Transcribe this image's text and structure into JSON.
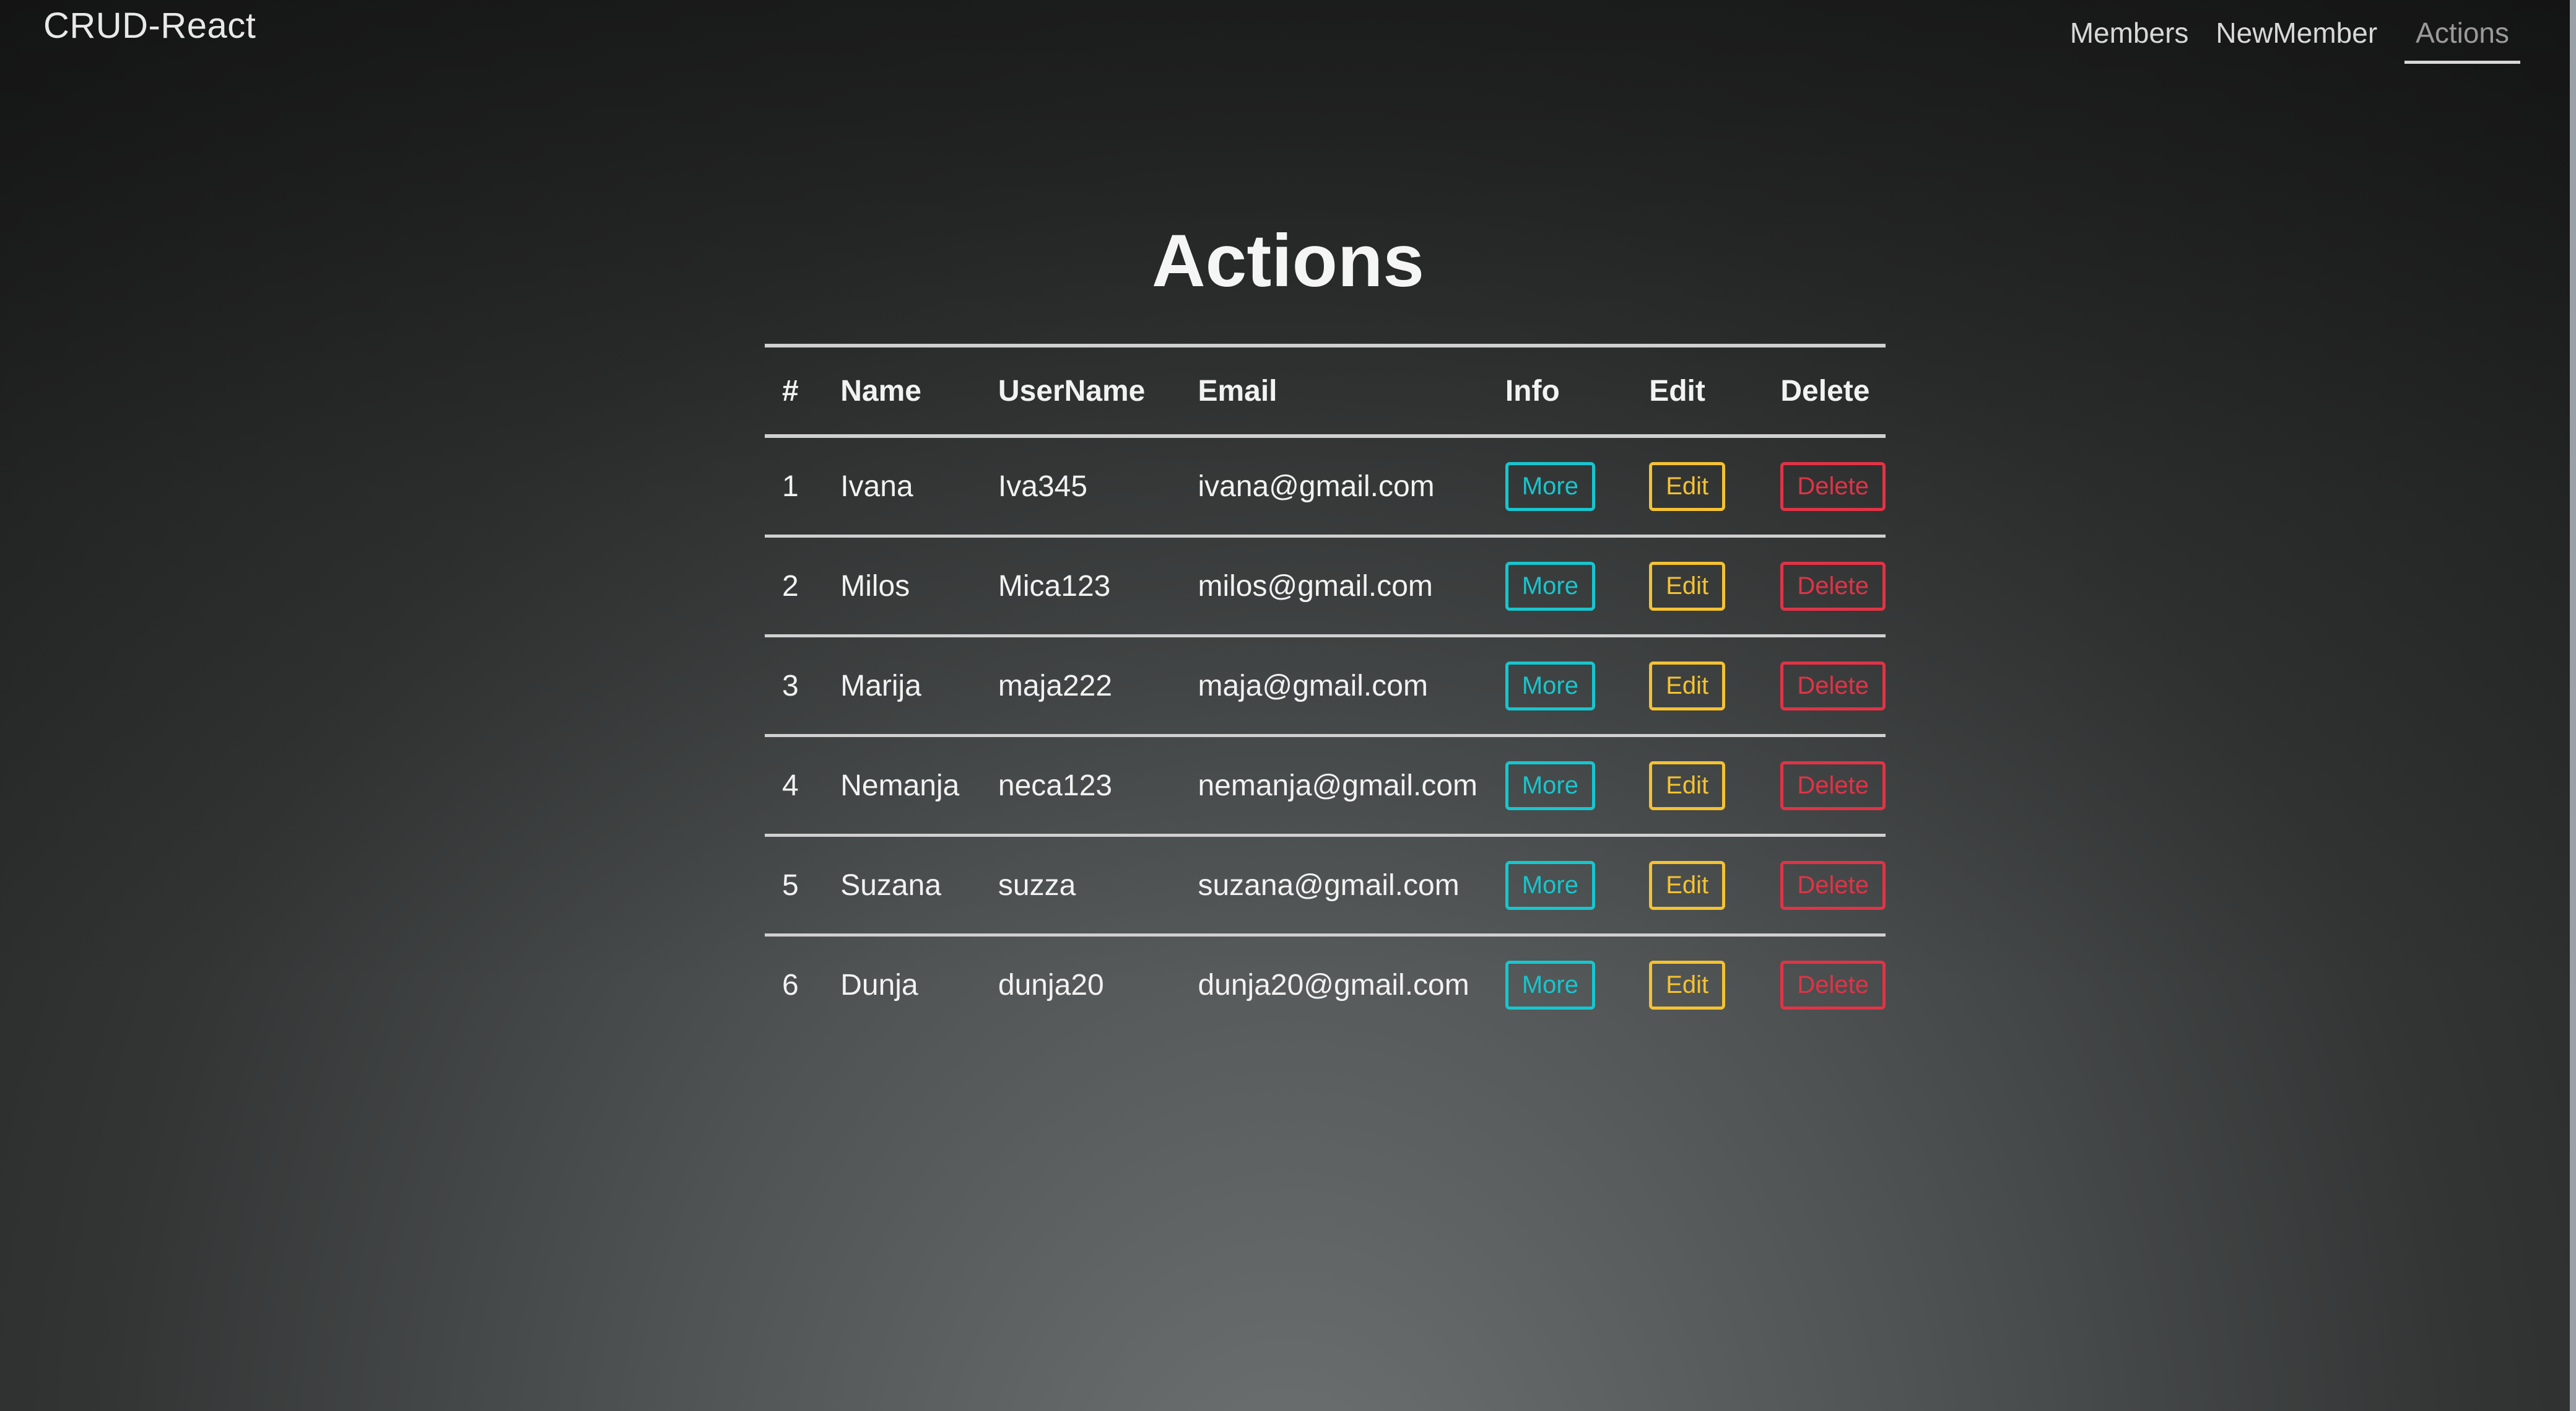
{
  "app": {
    "brand": "CRUD-React"
  },
  "nav": {
    "items": [
      "Members",
      "NewMember",
      "Actions"
    ],
    "active": "Actions"
  },
  "page": {
    "title": "Actions"
  },
  "table": {
    "headers": [
      "#",
      "Name",
      "UserName",
      "Email",
      "Info",
      "Edit",
      "Delete"
    ],
    "rows": [
      {
        "id": "1",
        "name": "Ivana",
        "username": "Iva345",
        "email": "ivana@gmail.com"
      },
      {
        "id": "2",
        "name": "Milos",
        "username": "Mica123",
        "email": "milos@gmail.com"
      },
      {
        "id": "3",
        "name": "Marija",
        "username": "maja222",
        "email": "maja@gmail.com"
      },
      {
        "id": "4",
        "name": "Nemanja",
        "username": "neca123",
        "email": "nemanja@gmail.com"
      },
      {
        "id": "5",
        "name": "Suzana",
        "username": "suzza",
        "email": "suzana@gmail.com"
      },
      {
        "id": "6",
        "name": "Dunja",
        "username": "dunja20",
        "email": "dunja20@gmail.com"
      }
    ],
    "buttons": {
      "info": "More",
      "edit": "Edit",
      "delete": "Delete"
    }
  },
  "colors": {
    "info": "#17c6cf",
    "edit": "#f4c232",
    "delete": "#e13346"
  }
}
